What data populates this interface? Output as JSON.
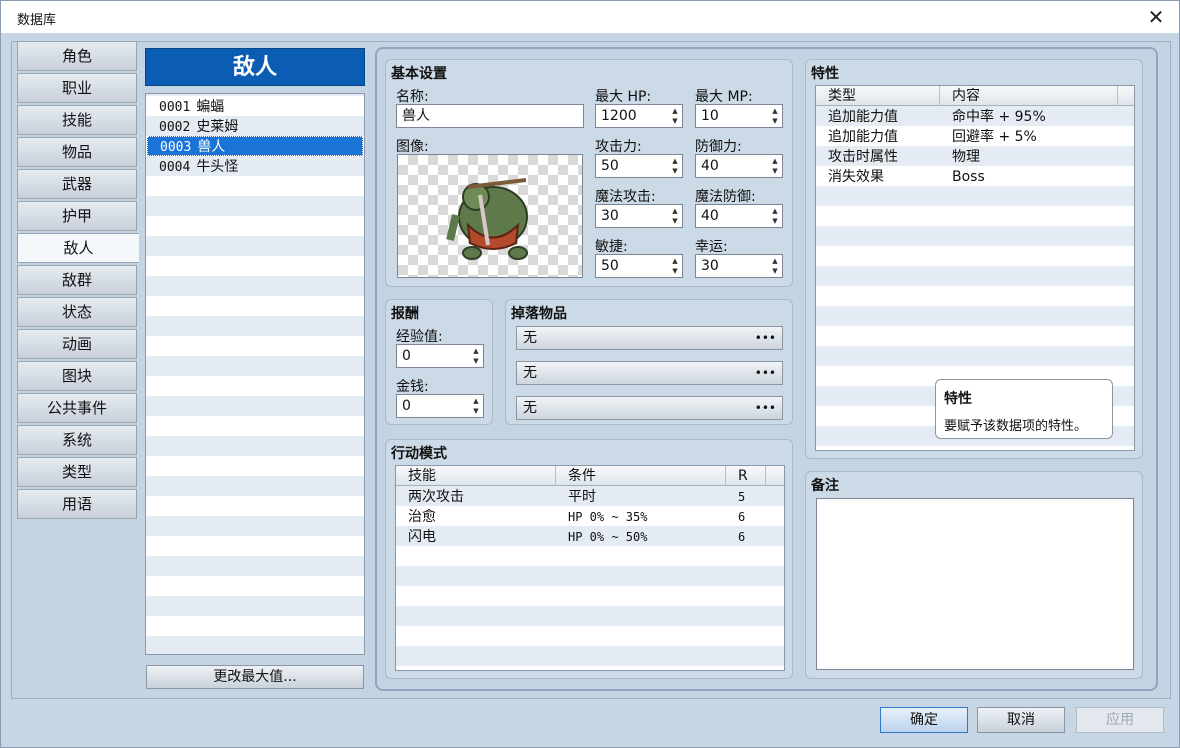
{
  "window": {
    "title": "数据库"
  },
  "categories": [
    "角色",
    "职业",
    "技能",
    "物品",
    "武器",
    "护甲",
    "敌人",
    "敌群",
    "状态",
    "动画",
    "图块",
    "公共事件",
    "系统",
    "类型",
    "用语"
  ],
  "active_category_index": 6,
  "list": {
    "header": "敌人",
    "items": [
      {
        "num": "0001",
        "name": "蝙蝠"
      },
      {
        "num": "0002",
        "name": "史莱姆"
      },
      {
        "num": "0003",
        "name": "兽人"
      },
      {
        "num": "0004",
        "name": "牛头怪"
      }
    ],
    "selected_index": 2,
    "change_max_label": "更改最大值..."
  },
  "basic": {
    "title": "基本设置",
    "name_label": "名称:",
    "name_value": "兽人",
    "image_label": "图像:",
    "max_hp_label": "最大 HP:",
    "max_hp": "1200",
    "max_mp_label": "最大 MP:",
    "max_mp": "10",
    "atk_label": "攻击力:",
    "atk": "50",
    "def_label": "防御力:",
    "def": "40",
    "mat_label": "魔法攻击:",
    "mat": "30",
    "mdf_label": "魔法防御:",
    "mdf": "40",
    "agi_label": "敏捷:",
    "agi": "50",
    "luk_label": "幸运:",
    "luk": "30"
  },
  "rewards": {
    "title": "报酬",
    "exp_label": "经验值:",
    "exp": "0",
    "gold_label": "金钱:",
    "gold": "0"
  },
  "drops": {
    "title": "掉落物品",
    "items": [
      "无",
      "无",
      "无"
    ],
    "button_icon": "ellipsis-icon"
  },
  "actions": {
    "title": "行动模式",
    "headers": [
      "技能",
      "条件",
      "R"
    ],
    "rows": [
      {
        "skill": "两次攻击",
        "cond": "平时",
        "r": "5"
      },
      {
        "skill": "治愈",
        "cond": "HP 0% ~ 35%",
        "r": "6"
      },
      {
        "skill": "闪电",
        "cond": "HP 0% ~ 50%",
        "r": "6"
      }
    ]
  },
  "traits": {
    "title": "特性",
    "headers": [
      "类型",
      "内容"
    ],
    "rows": [
      {
        "type": "追加能力值",
        "content": "命中率 + 95%"
      },
      {
        "type": "追加能力值",
        "content": "回避率 + 5%"
      },
      {
        "type": "攻击时属性",
        "content": "物理"
      },
      {
        "type": "消失效果",
        "content": "Boss"
      }
    ]
  },
  "tooltip": {
    "title": "特性",
    "body": "要赋予该数据项的特性。"
  },
  "note": {
    "title": "备注"
  },
  "buttons": {
    "ok": "确定",
    "cancel": "取消",
    "apply": "应用"
  },
  "spin_arrows": "▲▼"
}
